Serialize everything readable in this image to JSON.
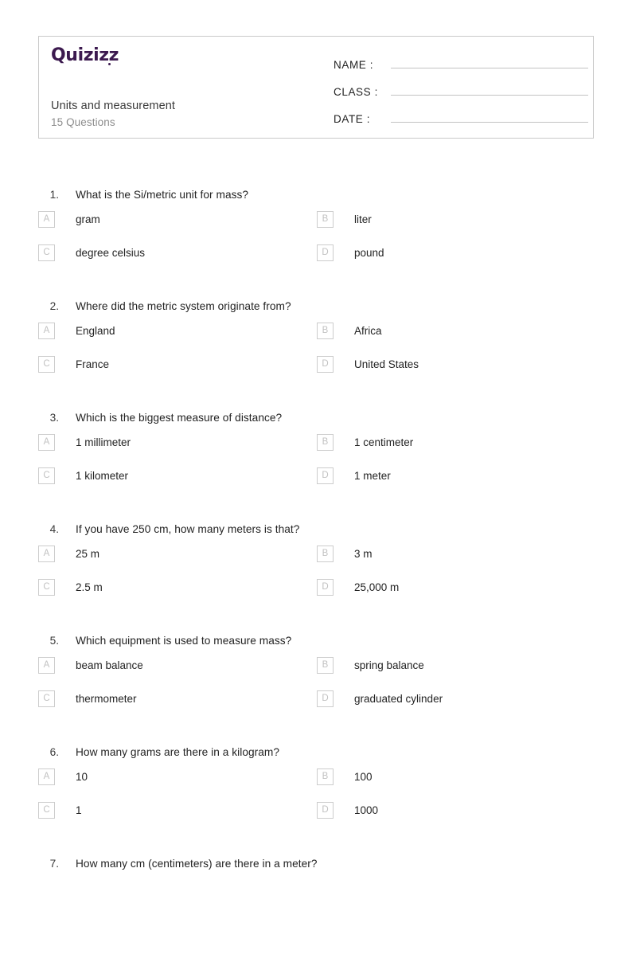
{
  "brand": {
    "logo_text": "Quizizz",
    "logo_color": "#3c1a4f"
  },
  "header": {
    "quiz_title": "Units and measurement",
    "question_count_label": "15 Questions",
    "fields": [
      {
        "label": "NAME :",
        "value": ""
      },
      {
        "label": "CLASS :",
        "value": ""
      },
      {
        "label": "DATE  :",
        "value": ""
      }
    ]
  },
  "questions": [
    {
      "number": "1.",
      "text": "What is the Si/metric unit for mass?",
      "options": [
        {
          "letter": "A",
          "text": "gram"
        },
        {
          "letter": "B",
          "text": "liter"
        },
        {
          "letter": "C",
          "text": "degree celsius"
        },
        {
          "letter": "D",
          "text": "pound"
        }
      ]
    },
    {
      "number": "2.",
      "text": "Where did the metric system originate from?",
      "options": [
        {
          "letter": "A",
          "text": "England"
        },
        {
          "letter": "B",
          "text": "Africa"
        },
        {
          "letter": "C",
          "text": "France"
        },
        {
          "letter": "D",
          "text": "United States"
        }
      ]
    },
    {
      "number": "3.",
      "text": "Which is the biggest measure of distance?",
      "options": [
        {
          "letter": "A",
          "text": "1 millimeter"
        },
        {
          "letter": "B",
          "text": "1 centimeter"
        },
        {
          "letter": "C",
          "text": "1 kilometer"
        },
        {
          "letter": "D",
          "text": "1 meter"
        }
      ]
    },
    {
      "number": "4.",
      "text": "If you have 250 cm, how many meters is that?",
      "options": [
        {
          "letter": "A",
          "text": "25 m"
        },
        {
          "letter": "B",
          "text": "3 m"
        },
        {
          "letter": "C",
          "text": "2.5 m"
        },
        {
          "letter": "D",
          "text": "25,000 m"
        }
      ]
    },
    {
      "number": "5.",
      "text": "Which equipment is used to measure mass?",
      "options": [
        {
          "letter": "A",
          "text": "beam balance"
        },
        {
          "letter": "B",
          "text": "spring balance"
        },
        {
          "letter": "C",
          "text": "thermometer"
        },
        {
          "letter": "D",
          "text": "graduated cylinder"
        }
      ]
    },
    {
      "number": "6.",
      "text": "How many grams are there in a kilogram?",
      "options": [
        {
          "letter": "A",
          "text": "10"
        },
        {
          "letter": "B",
          "text": "100"
        },
        {
          "letter": "C",
          "text": "1"
        },
        {
          "letter": "D",
          "text": "1000"
        }
      ]
    },
    {
      "number": "7.",
      "text": "How many cm (centimeters) are there in a meter?",
      "options": []
    }
  ]
}
